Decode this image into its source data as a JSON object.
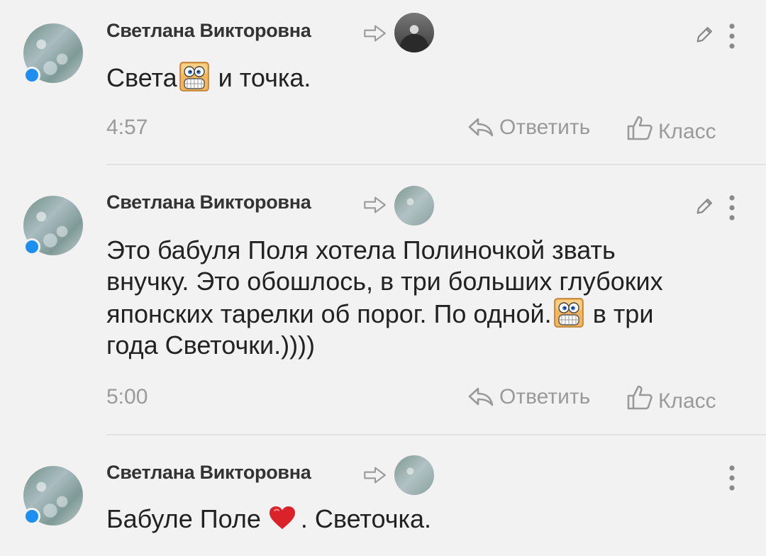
{
  "comments": [
    {
      "author": "Светлана Викторовна",
      "text_before": "Света",
      "text_after": "и точка.",
      "time": "4:57",
      "reply_label": "Ответить",
      "like_label": "Класс"
    },
    {
      "author": "Светлана Викторовна",
      "text_line1": "Это бабуля Поля хотела Полиночкой звать",
      "text_line2": "внучку. Это обошлось, в три больших глубоких",
      "text_line3_before": "японских тарелки об порог. По одной.",
      "text_line3_after": "в три",
      "text_line4": "года Светочки.))))",
      "time": "5:00",
      "reply_label": "Ответить",
      "like_label": "Класс"
    },
    {
      "author": "Светлана Викторовна",
      "text_before": "Бабуле Поле",
      "text_after": ". Светочка."
    }
  ],
  "colors": {
    "online": "#1e8ef0",
    "heart": "#d9222a",
    "meta": "#9a9a9a"
  },
  "icons": [
    "arrow-right-icon",
    "edit-icon",
    "more-icon",
    "reply-icon",
    "thumb-up-icon",
    "grin-emoji-icon",
    "heart-icon"
  ]
}
